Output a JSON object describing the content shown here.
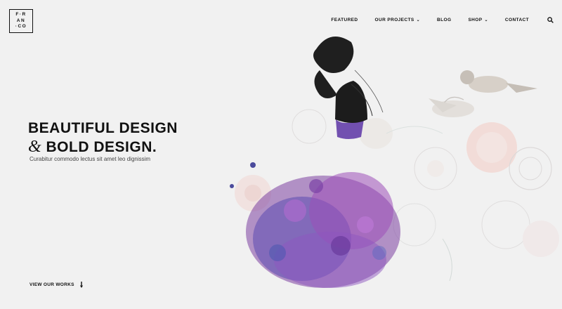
{
  "logo": {
    "row1": "F·R",
    "row2": "AN",
    "row3": "·CO"
  },
  "nav": {
    "items": [
      {
        "label": "FEATURED"
      },
      {
        "label": "OUR PROJECTS"
      },
      {
        "label": "BLOG"
      },
      {
        "label": "SHOP"
      },
      {
        "label": "CONTACT"
      }
    ],
    "search_icon": "search-icon"
  },
  "hero": {
    "line1": "BEAUTIFUL DESIGN",
    "amp": "&",
    "line2": "BOLD DESIGN.",
    "subtitle": "Curabitur commodo lectus sit amet leo dignissim"
  },
  "cta": {
    "label": "VIEW OUR WORKS",
    "icon": "arrow-down-icon"
  },
  "colors": {
    "background": "#f1f1f1",
    "text": "#111111",
    "purple": "#7b3fa0",
    "violet": "#5b4bb0"
  }
}
